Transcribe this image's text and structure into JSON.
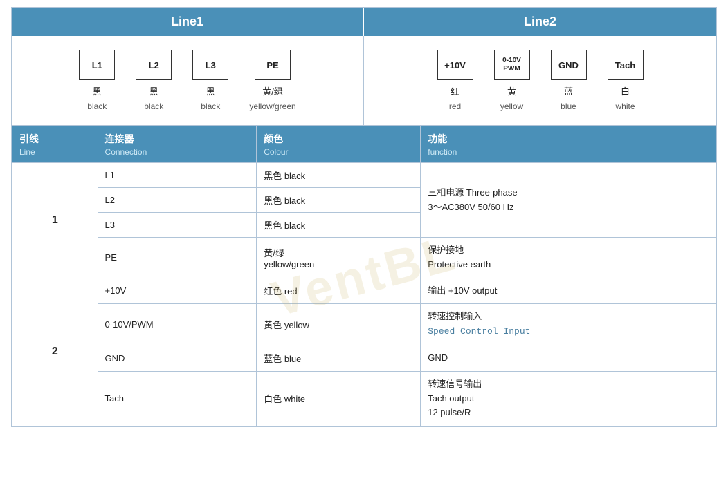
{
  "header": {
    "line1_label": "Line1",
    "line2_label": "Line2"
  },
  "line1_connectors": [
    {
      "id": "L1",
      "cn": "黑",
      "en": "black"
    },
    {
      "id": "L2",
      "cn": "黑",
      "en": "black"
    },
    {
      "id": "L3",
      "cn": "黑",
      "en": "black"
    },
    {
      "id": "PE",
      "cn": "黄/绿",
      "en": "yellow/green"
    }
  ],
  "line2_connectors": [
    {
      "id": "+10V",
      "cn": "红",
      "en": "red"
    },
    {
      "id": "0-10V\nPWM",
      "id_display": "0-10V\nPWM",
      "cn": "黄",
      "en": "yellow"
    },
    {
      "id": "GND",
      "cn": "蓝",
      "en": "blue"
    },
    {
      "id": "Tach",
      "cn": "白",
      "en": "white"
    }
  ],
  "table": {
    "headers": [
      {
        "cn": "引线",
        "en": "Line"
      },
      {
        "cn": "连接器",
        "en": "Connection"
      },
      {
        "cn": "颜色",
        "en": "Colour"
      },
      {
        "cn": "功能",
        "en": "function"
      }
    ],
    "rows": [
      {
        "line": "1",
        "rowspan": 4,
        "entries": [
          {
            "connection": "L1",
            "colour_cn": "黑色 black",
            "function": "三相电源 Three-phase\n3～AC380V 50/60 Hz",
            "function_rowspan": 3
          },
          {
            "connection": "L2",
            "colour_cn": "黑色 black",
            "function": null
          },
          {
            "connection": "L3",
            "colour_cn": "黑色 black",
            "function": null
          },
          {
            "connection": "PE",
            "colour_cn": "黄/绿\nyellow/green",
            "function": "保护接地\nProtective earth"
          }
        ]
      },
      {
        "line": "2",
        "rowspan": 4,
        "entries": [
          {
            "connection": "+10V",
            "colour_cn": "红色 red",
            "function": "输出 +10V output"
          },
          {
            "connection": "0-10V/PWM",
            "colour_cn": "黄色 yellow",
            "function": "转速控制输入\nSpeed Control Input",
            "function_mono": true
          },
          {
            "connection": "GND",
            "colour_cn": "蓝色 blue",
            "function": "GND"
          },
          {
            "connection": "Tach",
            "colour_cn": "白色 white",
            "function": "转速信号输出\nTach output\n12 pulse/R"
          }
        ]
      }
    ]
  },
  "watermark": "VentBL"
}
